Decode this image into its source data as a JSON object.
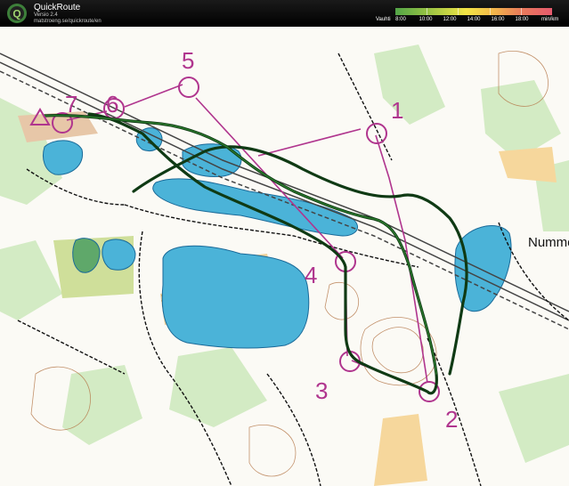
{
  "header": {
    "title": "QuickRoute",
    "version": "Versio 2.4",
    "url": "matstroeng.se/quickroute/en",
    "logo_letter": "Q"
  },
  "speed_legend": {
    "label": "Vauhti",
    "ticks": [
      "8:00",
      "10:00",
      "12:00",
      "14:00",
      "16:00",
      "18:00"
    ],
    "unit": "min/km",
    "colors": [
      "#52a447",
      "#9bc444",
      "#f3e545",
      "#f2b84a",
      "#e97b5a",
      "#e65a6e"
    ]
  },
  "map": {
    "place_label": "Nummela",
    "controls": [
      "1",
      "2",
      "3",
      "4",
      "5",
      "6",
      "7"
    ],
    "colors": {
      "water": "#4bb3d8",
      "course": "#b0358e",
      "route": "#1e4d1e",
      "open_land": "#f4d49a",
      "forest": "#ffffff"
    }
  }
}
